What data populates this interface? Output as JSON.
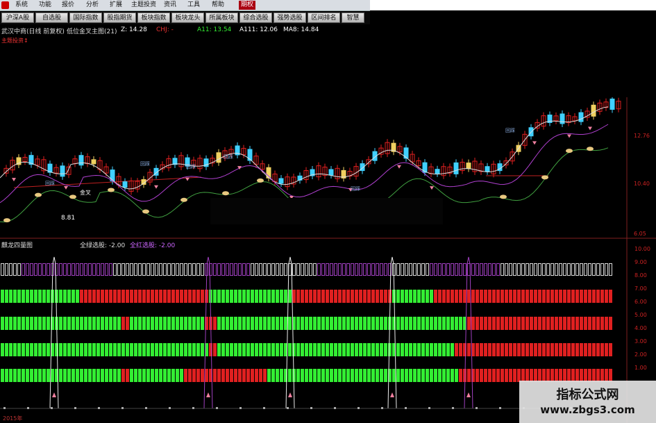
{
  "menu": [
    "系统",
    "功能",
    "报价",
    "分析",
    "扩展",
    "主题投资",
    "资讯",
    "工具",
    "帮助",
    "期权"
  ],
  "toolbar": [
    "沪深A股",
    "自选股",
    "国际指数",
    "股指期货",
    "板块指数",
    "板块龙头",
    "所属板块",
    "综合选股",
    "强势选股",
    "区间排名",
    "智慧"
  ],
  "info": {
    "stock": "武汉中商(日线 前复权)",
    "indicator": "低位金叉主图(21)",
    "z": "Z: 14.28",
    "chj": "CHJ: -",
    "a11": "A11: 13.54",
    "a111": "A111: 12.06",
    "ma8": "MA8: 14.84"
  },
  "subtitle": "主题投资↕",
  "price_ticks": [
    "12.76",
    "10.40",
    "6.05"
  ],
  "chart_labels": {
    "low": "8.81",
    "cross": "金叉",
    "back": "回踩"
  },
  "indicator": {
    "title": "麒龙四量图",
    "green_pick": "全绿选股: -2.00",
    "red_pick": "全红选股: -2.00"
  },
  "ind_ticks": [
    "10.00",
    "9.00",
    "8.00",
    "7.00",
    "6.00",
    "5.00",
    "4.00",
    "3.00",
    "2.00",
    "1.00"
  ],
  "footer": "2015年",
  "watermark": {
    "line1": "指标公式网",
    "line2": "www.zbgs3.com"
  },
  "colors": {
    "up": "#e02020",
    "down": "#40d0ff",
    "gold": "#f0d060",
    "green": "#33ee33",
    "red": "#e02020",
    "purple": "#a040c0",
    "white": "#cccccc"
  }
}
